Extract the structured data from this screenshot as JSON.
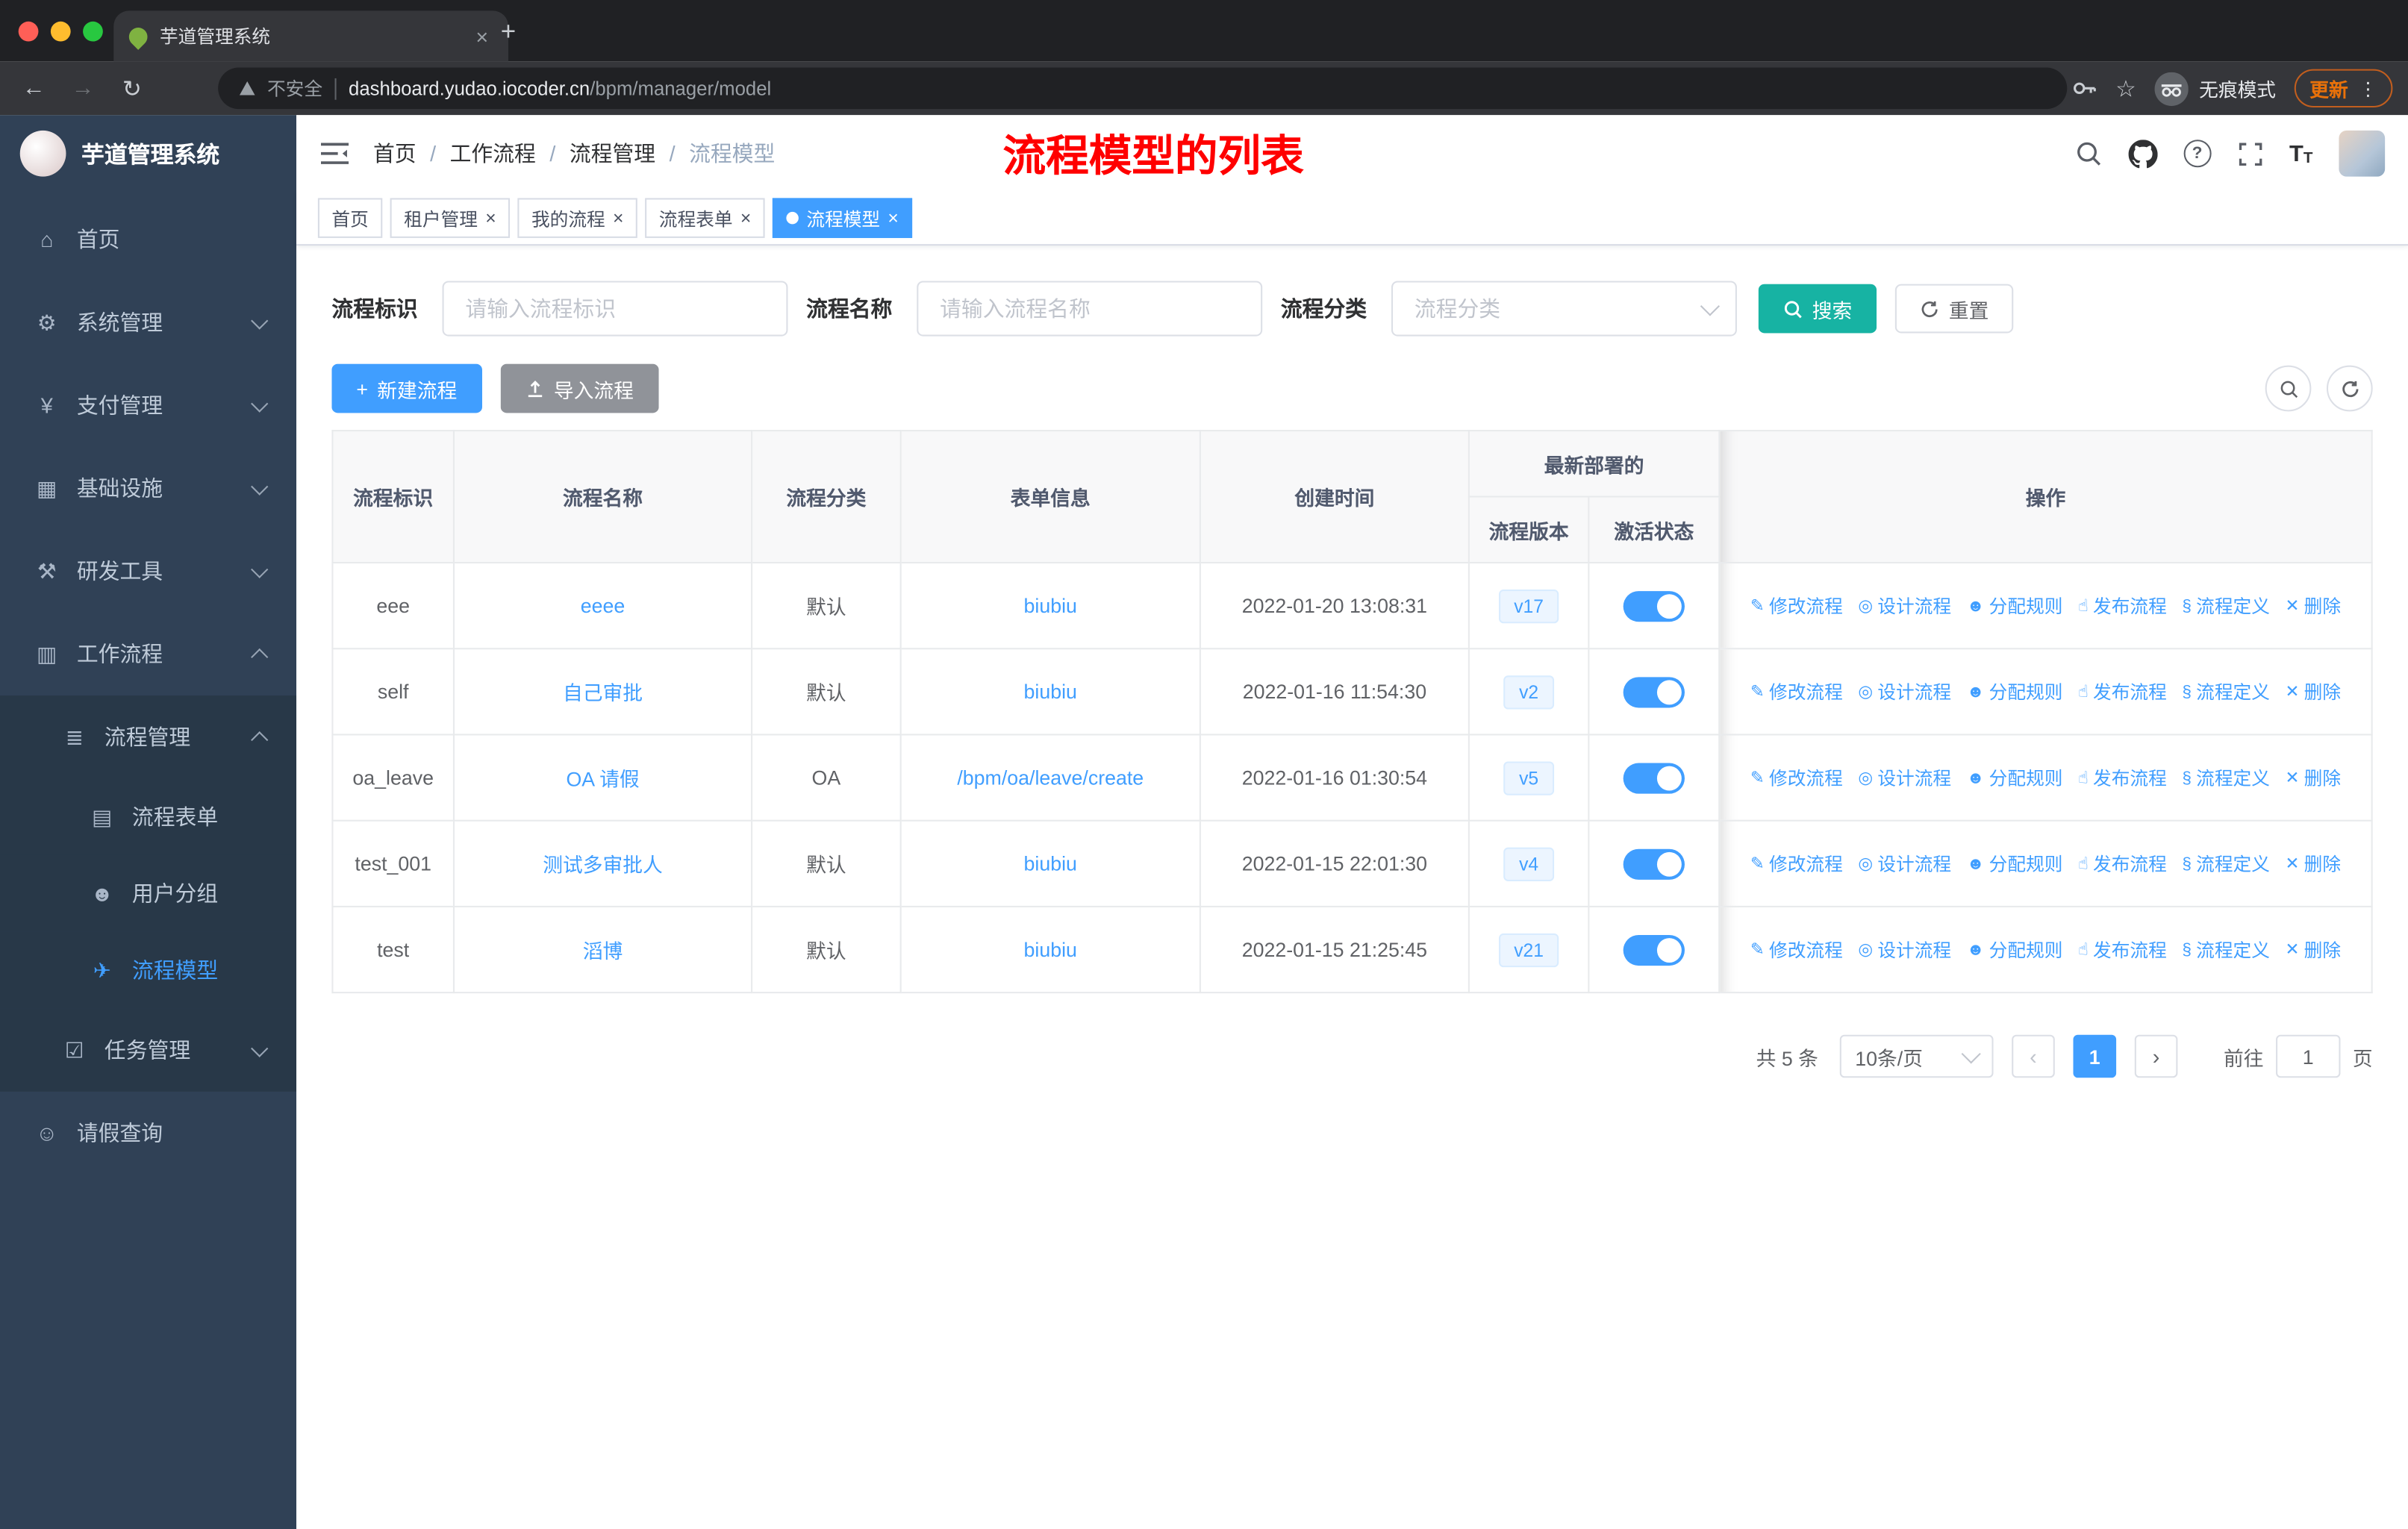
{
  "browser": {
    "tab_title": "芋道管理系统",
    "security_label": "不安全",
    "url_host": "dashboard.yudao.iocoder.cn",
    "url_path": "/bpm/manager/model",
    "incognito_label": "无痕模式",
    "update_label": "更新"
  },
  "sidebar": {
    "logo_title": "芋道管理系统",
    "items": [
      {
        "name": "home",
        "label": "首页",
        "icon": "dashboard-icon",
        "glyph": "⌂",
        "depth": 1,
        "arrow": "",
        "sub": false,
        "active": false
      },
      {
        "name": "system",
        "label": "系统管理",
        "icon": "gear-icon",
        "glyph": "⚙",
        "depth": 1,
        "arrow": "down",
        "sub": false,
        "active": false
      },
      {
        "name": "payment",
        "label": "支付管理",
        "icon": "yen-icon",
        "glyph": "¥",
        "depth": 1,
        "arrow": "down",
        "sub": false,
        "active": false
      },
      {
        "name": "infra",
        "label": "基础设施",
        "icon": "infra-icon",
        "glyph": "▦",
        "depth": 1,
        "arrow": "down",
        "sub": false,
        "active": false
      },
      {
        "name": "devtools",
        "label": "研发工具",
        "icon": "tools-icon",
        "glyph": "⚒",
        "depth": 1,
        "arrow": "down",
        "sub": false,
        "active": false
      },
      {
        "name": "workflow",
        "label": "工作流程",
        "icon": "workflow-icon",
        "glyph": "▥",
        "depth": 1,
        "arrow": "up",
        "sub": false,
        "active": false
      },
      {
        "name": "process-manage",
        "label": "流程管理",
        "icon": "list-icon",
        "glyph": "≣",
        "depth": 2,
        "arrow": "up",
        "sub": true,
        "active": false
      },
      {
        "name": "process-form",
        "label": "流程表单",
        "icon": "form-icon",
        "glyph": "▤",
        "depth": 3,
        "arrow": "",
        "sub": true,
        "active": false
      },
      {
        "name": "user-group",
        "label": "用户分组",
        "icon": "users-icon",
        "glyph": "☻",
        "depth": 3,
        "arrow": "",
        "sub": true,
        "active": false
      },
      {
        "name": "process-model",
        "label": "流程模型",
        "icon": "paper-plane-icon",
        "glyph": "✈",
        "depth": 3,
        "arrow": "",
        "sub": true,
        "active": true
      },
      {
        "name": "task-manage",
        "label": "任务管理",
        "icon": "task-icon",
        "glyph": "☑",
        "depth": 2,
        "arrow": "down",
        "sub": true,
        "active": false
      },
      {
        "name": "leave-query",
        "label": "请假查询",
        "icon": "user-icon",
        "glyph": "☺",
        "depth": 1,
        "arrow": "",
        "sub": false,
        "active": false
      }
    ]
  },
  "header": {
    "breadcrumb": [
      {
        "label": "首页",
        "current": false
      },
      {
        "label": "工作流程",
        "current": false
      },
      {
        "label": "流程管理",
        "current": false
      },
      {
        "label": "流程模型",
        "current": true
      }
    ],
    "annotation": "流程模型的列表"
  },
  "tags": [
    {
      "label": "首页",
      "closable": false,
      "active": false
    },
    {
      "label": "租户管理",
      "closable": true,
      "active": false
    },
    {
      "label": "我的流程",
      "closable": true,
      "active": false
    },
    {
      "label": "流程表单",
      "closable": true,
      "active": false
    },
    {
      "label": "流程模型",
      "closable": true,
      "active": true
    }
  ],
  "filters": {
    "id_label": "流程标识",
    "id_placeholder": "请输入流程标识",
    "name_label": "流程名称",
    "name_placeholder": "请输入流程名称",
    "category_label": "流程分类",
    "category_placeholder": "流程分类",
    "search_label": "搜索",
    "reset_label": "重置"
  },
  "toolbar": {
    "create_label": "新建流程",
    "import_label": "导入流程"
  },
  "table": {
    "group_header": "最新部署的",
    "columns": {
      "id": "流程标识",
      "name": "流程名称",
      "category": "流程分类",
      "form": "表单信息",
      "created": "创建时间",
      "version": "流程版本",
      "state": "激活状态",
      "ops": "操作"
    },
    "actions": [
      {
        "label": "修改流程",
        "icon": "edit-icon",
        "glyph": "✎"
      },
      {
        "label": "设计流程",
        "icon": "design-icon",
        "glyph": "◎"
      },
      {
        "label": "分配规则",
        "icon": "assign-rule-icon",
        "glyph": "☻"
      },
      {
        "label": "发布流程",
        "icon": "publish-icon",
        "glyph": "☝"
      },
      {
        "label": "流程定义",
        "icon": "definition-icon",
        "glyph": "§"
      },
      {
        "label": "删除",
        "icon": "delete-icon",
        "glyph": "✕"
      }
    ],
    "rows": [
      {
        "id": "eee",
        "name": "eeee",
        "category": "默认",
        "form": "biubiu",
        "created": "2022-01-20 13:08:31",
        "version": "v17",
        "active": true
      },
      {
        "id": "self",
        "name": "自己审批",
        "category": "默认",
        "form": "biubiu",
        "created": "2022-01-16 11:54:30",
        "version": "v2",
        "active": true
      },
      {
        "id": "oa_leave",
        "name": "OA 请假",
        "category": "OA",
        "form": "/bpm/oa/leave/create",
        "created": "2022-01-16 01:30:54",
        "version": "v5",
        "active": true
      },
      {
        "id": "test_001",
        "name": "测试多审批人",
        "category": "默认",
        "form": "biubiu",
        "created": "2022-01-15 22:01:30",
        "version": "v4",
        "active": true
      },
      {
        "id": "test",
        "name": "滔博",
        "category": "默认",
        "form": "biubiu",
        "created": "2022-01-15 21:25:45",
        "version": "v21",
        "active": true
      }
    ]
  },
  "pagination": {
    "total": "共 5 条",
    "page_size": "10条/页",
    "prev": "‹",
    "next": "›",
    "current": "1",
    "goto_label": "前往",
    "goto_value": "1",
    "unit_label": "页"
  },
  "colors": {
    "primary": "#409eff",
    "search_button": "#17b3a3",
    "import_button": "#909399",
    "sidebar_bg": "#304156",
    "sidebar_sub_bg": "#283848",
    "annotation_red": "#ff0000",
    "tag_version_bg": "#ecf5ff",
    "table_header_bg": "#f8f8f9"
  }
}
